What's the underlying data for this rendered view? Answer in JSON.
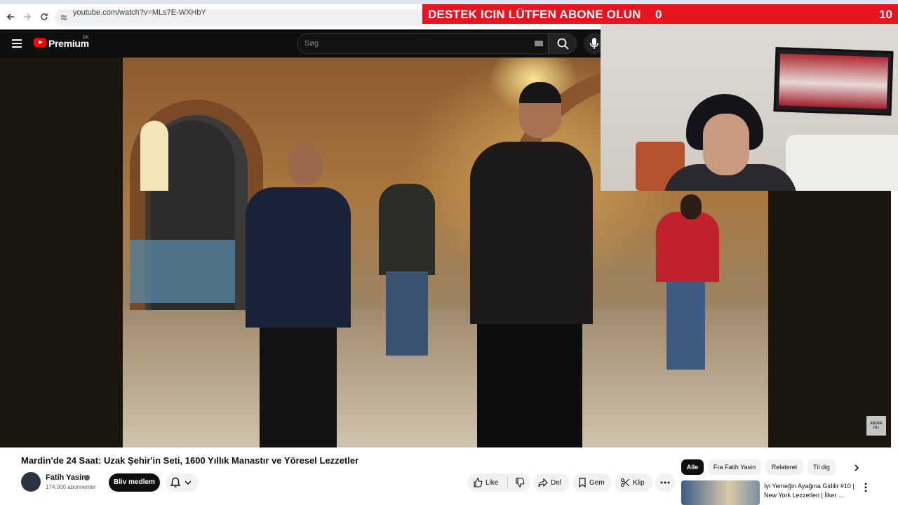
{
  "browser": {
    "url": "youtube.com/watch?v=MLs7E-WXHbY"
  },
  "overlay": {
    "banner_text": "DESTEK ICIN LÜTFEN ABONE OLUN",
    "current_count": "0",
    "goal_count": "10",
    "watermark_text": "ABONE OL!"
  },
  "header": {
    "brand": "Premium",
    "country_code": "DK",
    "search_placeholder": "Søg"
  },
  "video": {
    "title": "Mardin'de 24 Saat: Uzak Şehir'in Seti, 1600 Yıllık Manastır ve Yöresel Lezzetler"
  },
  "channel": {
    "name": "Fatih Yasin",
    "subscribers": "174.000 abonnenter",
    "join_label": "Bliv medlem"
  },
  "actions": {
    "like_label": "Like",
    "share_label": "Del",
    "save_label": "Gem",
    "clip_label": "Klip"
  },
  "chips": [
    "Alle",
    "Fra Fatih Yasin",
    "Relateret",
    "Til dig"
  ],
  "recommendation": {
    "title": "İyi Yemeğin Ayağına Gidilir #10 | New York Lezzetleri | İlker ..."
  },
  "colors": {
    "banner": "#e8141f",
    "youtube_red": "#ff0000",
    "header_bg": "#0f0f0f"
  }
}
